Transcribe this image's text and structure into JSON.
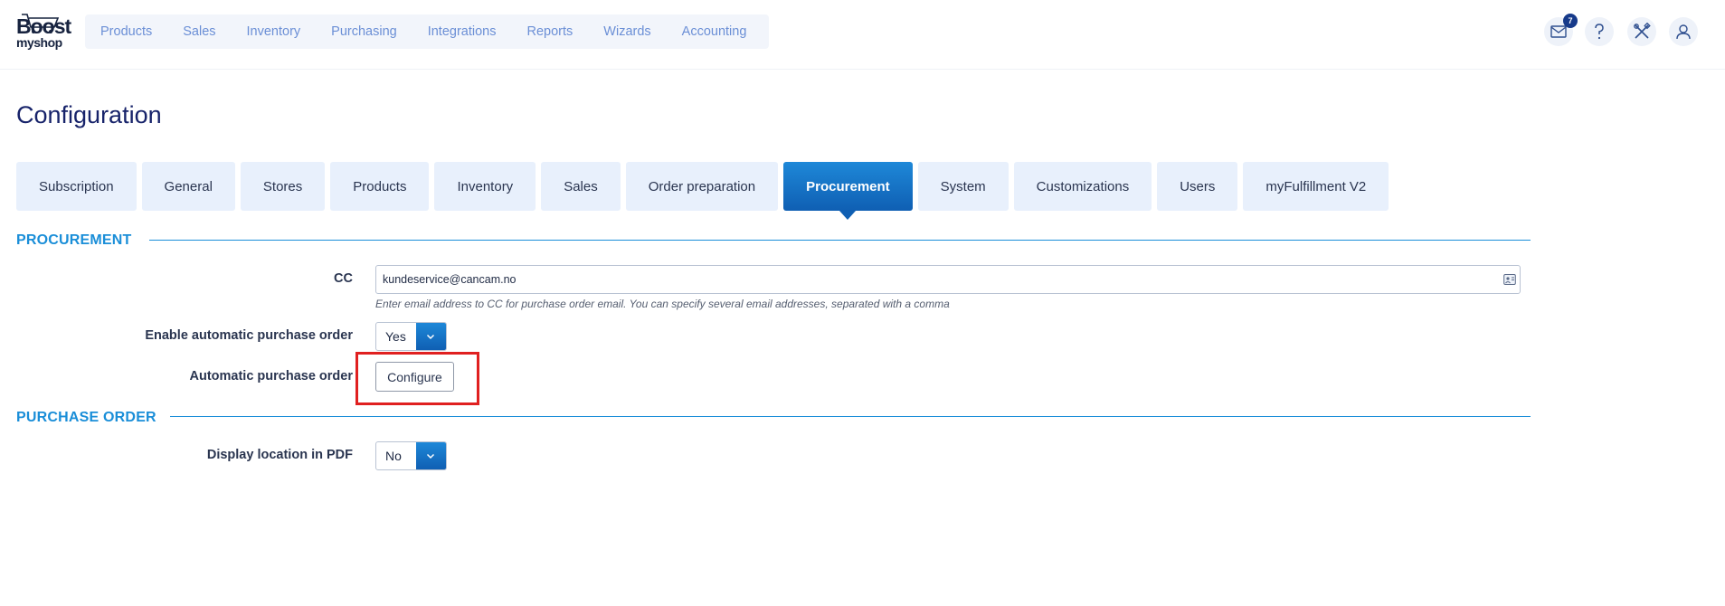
{
  "app": {
    "logo_line1": "Boost",
    "logo_line2": "myshop"
  },
  "main_nav": [
    "Products",
    "Sales",
    "Inventory",
    "Purchasing",
    "Integrations",
    "Reports",
    "Wizards",
    "Accounting"
  ],
  "toolbar": {
    "mail_badge": "7"
  },
  "page": {
    "title": "Configuration"
  },
  "tabs": [
    "Subscription",
    "General",
    "Stores",
    "Products",
    "Inventory",
    "Sales",
    "Order preparation",
    "Procurement",
    "System",
    "Customizations",
    "Users",
    "myFulfillment V2"
  ],
  "active_tab": "Procurement",
  "procurement": {
    "section_title": "PROCUREMENT",
    "cc_label": "CC",
    "cc_value": "kundeservice@cancam.no",
    "cc_hint": "Enter email address to CC for purchase order email. You can specify several email addresses, separated with a comma",
    "auto_po_label": "Enable automatic purchase order",
    "auto_po_value": "Yes",
    "auto_po_config_label": "Automatic purchase order",
    "configure_button": "Configure"
  },
  "purchase_order": {
    "section_title": "PURCHASE ORDER",
    "display_location_label": "Display location in PDF",
    "display_location_value": "No"
  },
  "colors": {
    "accent": "#1a8ed8",
    "highlight": "#e02020"
  }
}
